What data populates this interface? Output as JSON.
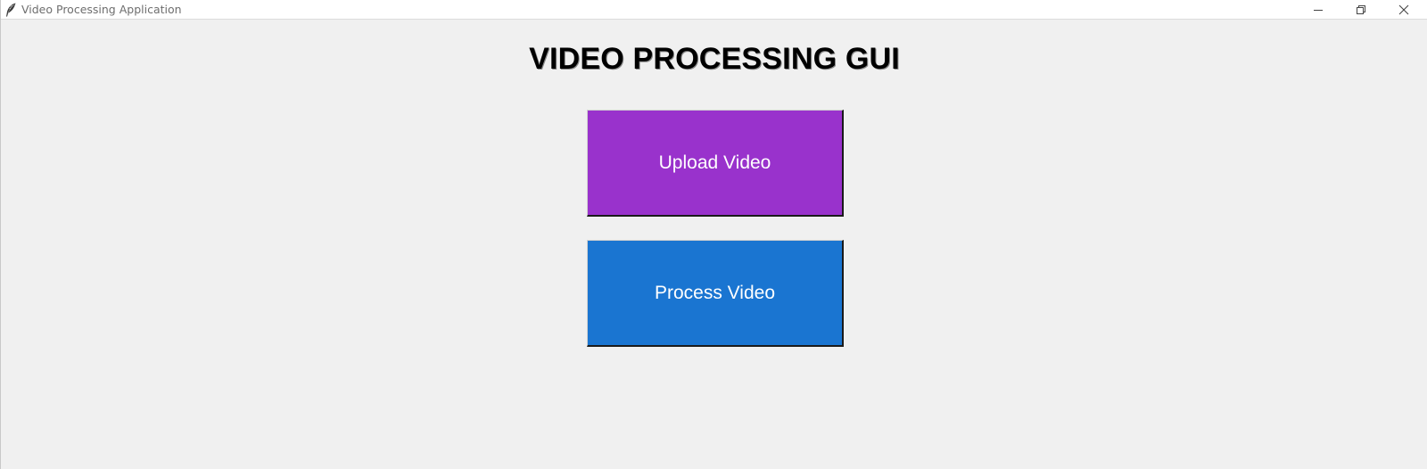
{
  "window": {
    "title": "Video Processing Application",
    "controls": {
      "minimize": "minimize-icon",
      "maximize": "restore-icon",
      "close": "close-icon"
    }
  },
  "main": {
    "heading": "VIDEO PROCESSING GUI",
    "buttons": [
      {
        "label": "Upload Video",
        "color": "#9932cc"
      },
      {
        "label": "Process Video",
        "color": "#1a75d1"
      }
    ]
  },
  "colors": {
    "background": "#f0f0f0",
    "titlebar": "#ffffff"
  }
}
